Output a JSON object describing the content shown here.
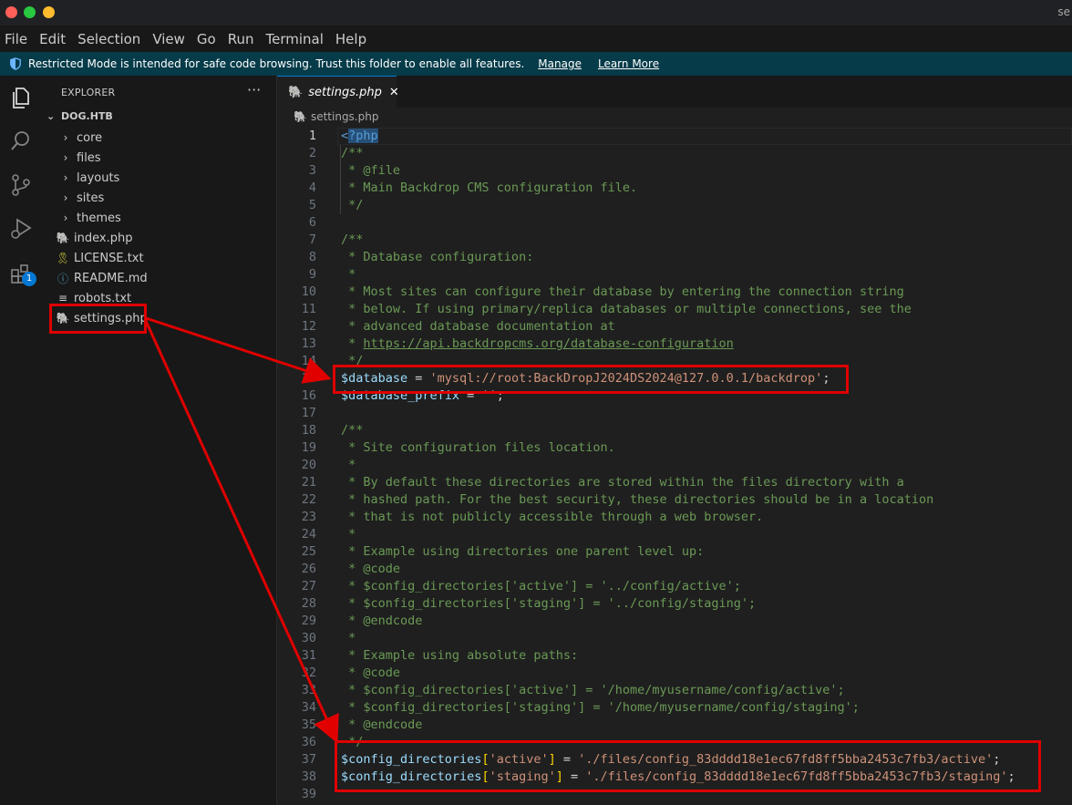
{
  "window": {
    "title": "se"
  },
  "menu": [
    "File",
    "Edit",
    "Selection",
    "View",
    "Go",
    "Run",
    "Terminal",
    "Help"
  ],
  "banner": {
    "icon": "shield-icon",
    "message": "Restricted Mode is intended for safe code browsing. Trust this folder to enable all features.",
    "manage": "Manage",
    "learn_more": "Learn More"
  },
  "activity": {
    "extensions_badge": "1"
  },
  "explorer": {
    "title": "EXPLORER",
    "more": "···",
    "root": "DOG.HTB",
    "folders": [
      "core",
      "files",
      "layouts",
      "sites",
      "themes"
    ],
    "files": [
      {
        "name": "index.php",
        "icon": "php-elephant-icon"
      },
      {
        "name": "LICENSE.txt",
        "icon": "license-icon"
      },
      {
        "name": "README.md",
        "icon": "info-icon"
      },
      {
        "name": "robots.txt",
        "icon": "lines-icon"
      },
      {
        "name": "settings.php",
        "icon": "php-elephant-icon"
      }
    ]
  },
  "editor": {
    "tab": "settings.php",
    "breadcrumb": "settings.php",
    "active_line": 1,
    "lines": [
      {
        "n": "1",
        "t": [
          [
            "tag",
            "<"
          ],
          [
            "sel",
            "?php"
          ]
        ]
      },
      {
        "n": "2",
        "t": [
          [
            "com",
            "/**"
          ]
        ]
      },
      {
        "n": "3",
        "t": [
          [
            "com",
            " * @file"
          ]
        ]
      },
      {
        "n": "4",
        "t": [
          [
            "com",
            " * Main Backdrop CMS configuration file."
          ]
        ]
      },
      {
        "n": "5",
        "t": [
          [
            "com",
            " */"
          ]
        ]
      },
      {
        "n": "6",
        "t": []
      },
      {
        "n": "7",
        "t": [
          [
            "com",
            "/**"
          ]
        ]
      },
      {
        "n": "8",
        "t": [
          [
            "com",
            " * Database configuration:"
          ]
        ]
      },
      {
        "n": "9",
        "t": [
          [
            "com",
            " *"
          ]
        ]
      },
      {
        "n": "10",
        "t": [
          [
            "com",
            " * Most sites can configure their database by entering the connection string"
          ]
        ]
      },
      {
        "n": "11",
        "t": [
          [
            "com",
            " * below. If using primary/replica databases or multiple connections, see the"
          ]
        ]
      },
      {
        "n": "12",
        "t": [
          [
            "com",
            " * advanced database documentation at"
          ]
        ]
      },
      {
        "n": "13",
        "t": [
          [
            "com",
            " * "
          ],
          [
            "url",
            "https://api.backdropcms.org/database-configuration"
          ]
        ]
      },
      {
        "n": "14",
        "t": [
          [
            "com",
            " */"
          ]
        ]
      },
      {
        "n": "15",
        "t": [
          [
            "var",
            "$database"
          ],
          [
            "op",
            " = "
          ],
          [
            "str",
            "'mysql://root:BackDropJ2024DS2024@127.0.0.1/backdrop'"
          ],
          [
            "op",
            ";"
          ]
        ]
      },
      {
        "n": "16",
        "t": [
          [
            "var",
            "$database_prefix"
          ],
          [
            "op",
            " = "
          ],
          [
            "str",
            "''"
          ],
          [
            "op",
            ";"
          ]
        ]
      },
      {
        "n": "17",
        "t": []
      },
      {
        "n": "18",
        "t": [
          [
            "com",
            "/**"
          ]
        ]
      },
      {
        "n": "19",
        "t": [
          [
            "com",
            " * Site configuration files location."
          ]
        ]
      },
      {
        "n": "20",
        "t": [
          [
            "com",
            " *"
          ]
        ]
      },
      {
        "n": "21",
        "t": [
          [
            "com",
            " * By default these directories are stored within the files directory with a"
          ]
        ]
      },
      {
        "n": "22",
        "t": [
          [
            "com",
            " * hashed path. For the best security, these directories should be in a location"
          ]
        ]
      },
      {
        "n": "23",
        "t": [
          [
            "com",
            " * that is not publicly accessible through a web browser."
          ]
        ]
      },
      {
        "n": "24",
        "t": [
          [
            "com",
            " *"
          ]
        ]
      },
      {
        "n": "25",
        "t": [
          [
            "com",
            " * Example using directories one parent level up:"
          ]
        ]
      },
      {
        "n": "26",
        "t": [
          [
            "com",
            " * @code"
          ]
        ]
      },
      {
        "n": "27",
        "t": [
          [
            "com",
            " * $config_directories['active'] = '../config/active';"
          ]
        ]
      },
      {
        "n": "28",
        "t": [
          [
            "com",
            " * $config_directories['staging'] = '../config/staging';"
          ]
        ]
      },
      {
        "n": "29",
        "t": [
          [
            "com",
            " * @endcode"
          ]
        ]
      },
      {
        "n": "30",
        "t": [
          [
            "com",
            " *"
          ]
        ]
      },
      {
        "n": "31",
        "t": [
          [
            "com",
            " * Example using absolute paths:"
          ]
        ]
      },
      {
        "n": "32",
        "t": [
          [
            "com",
            " * @code"
          ]
        ]
      },
      {
        "n": "33",
        "t": [
          [
            "com",
            " * $config_directories['active'] = '/home/myusername/config/active';"
          ]
        ]
      },
      {
        "n": "34",
        "t": [
          [
            "com",
            " * $config_directories['staging'] = '/home/myusername/config/staging';"
          ]
        ]
      },
      {
        "n": "35",
        "t": [
          [
            "com",
            " * @endcode"
          ]
        ]
      },
      {
        "n": "36",
        "t": [
          [
            "com",
            " */"
          ]
        ]
      },
      {
        "n": "37",
        "t": [
          [
            "var",
            "$config_directories"
          ],
          [
            "brk",
            "["
          ],
          [
            "str",
            "'active'"
          ],
          [
            "brk",
            "]"
          ],
          [
            "op",
            " = "
          ],
          [
            "str",
            "'./files/config_83dddd18e1ec67fd8ff5bba2453c7fb3/active'"
          ],
          [
            "op",
            ";"
          ]
        ]
      },
      {
        "n": "38",
        "t": [
          [
            "var",
            "$config_directories"
          ],
          [
            "brk",
            "["
          ],
          [
            "str",
            "'staging'"
          ],
          [
            "brk",
            "]"
          ],
          [
            "op",
            " = "
          ],
          [
            "str",
            "'./files/config_83dddd18e1ec67fd8ff5bba2453c7fb3/staging'"
          ],
          [
            "op",
            ";"
          ]
        ]
      },
      {
        "n": "39",
        "t": []
      }
    ]
  },
  "annotation_color": "#e00000"
}
